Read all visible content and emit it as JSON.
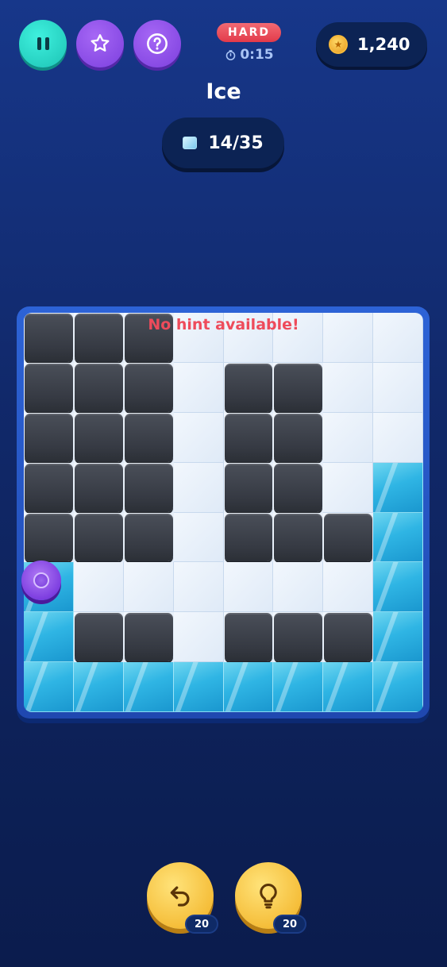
{
  "header": {
    "difficulty": "HARD",
    "timer": "0:15",
    "coins": "1,240",
    "icons": {
      "pause": "pause-icon",
      "favorite": "star-icon",
      "help": "question-icon",
      "timer": "stopwatch-icon",
      "coin": "coin-icon"
    }
  },
  "level": {
    "title": "Ice",
    "progress": "14/35",
    "progress_icon": "ice-cube-icon"
  },
  "board": {
    "message": "No hint available!",
    "rows": 8,
    "cols": 8,
    "legend": {
      "W": "wall",
      "F": "floor",
      "I": "ice"
    },
    "layout": [
      "WWWFFFFF",
      "WWWFWWFF",
      "WWWFWWFF",
      "WWWFWWFI",
      "WWWFWWWI",
      "IFFFFFFI",
      "IWWFWWWI",
      "IIIIIIII"
    ],
    "player": {
      "row": 6,
      "col": 1
    }
  },
  "powerups": {
    "undo": {
      "icon": "undo-icon",
      "count": "20"
    },
    "hint": {
      "icon": "lightbulb-icon",
      "count": "20"
    }
  },
  "colors": {
    "accent_teal": "#1cc3b4",
    "accent_purple": "#7c3fde",
    "difficulty_red": "#e23a4a",
    "hint_message_red": "#ee4b5b",
    "powerup_yellow": "#f5be3a",
    "wall": "#363a43",
    "ice": "#2fb5e4"
  }
}
